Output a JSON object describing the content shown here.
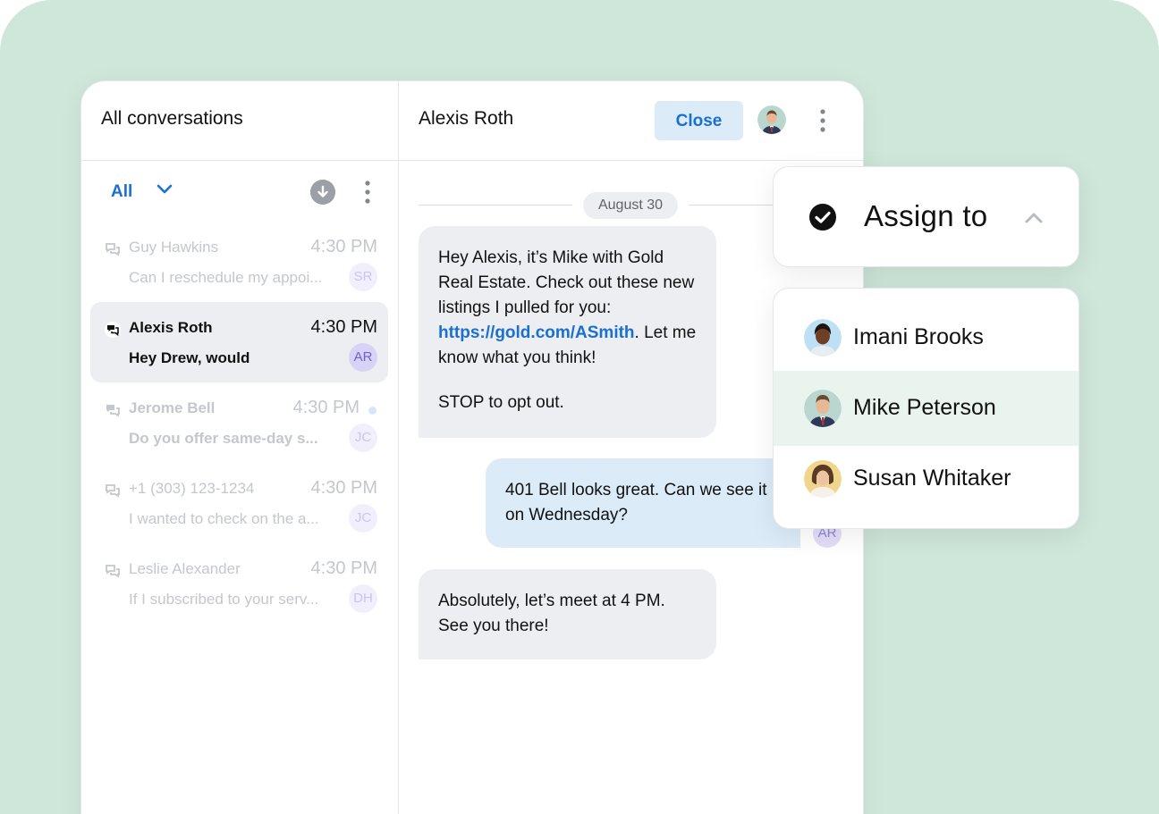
{
  "left": {
    "title": "All conversations",
    "filter_label": "All",
    "conversations": [
      {
        "name": "Guy Hawkins",
        "time": "4:30 PM",
        "preview": "Can I reschedule my appoi...",
        "initials": "SR"
      },
      {
        "name": "Alexis Roth",
        "time": "4:30 PM",
        "preview": "Hey Drew, would",
        "initials": "AR"
      },
      {
        "name": "Jerome Bell",
        "time": "4:30 PM",
        "preview": "Do you offer same-day s...",
        "initials": "JC"
      },
      {
        "name": "+1 (303) 123-1234",
        "time": "4:30 PM",
        "preview": "I wanted to check on the a...",
        "initials": "JC"
      },
      {
        "name": "Leslie Alexander",
        "time": "4:30 PM",
        "preview": "If I subscribed to your serv...",
        "initials": "DH"
      }
    ]
  },
  "right": {
    "contact_name": "Alexis Roth",
    "close_label": "Close",
    "date": "August 30",
    "messages": [
      {
        "text_before": "Hey Alexis, it’s Mike with Gold Real Estate. Check out these new listings I pulled for you: ",
        "link": "https://gold.com/ASmith",
        "text_after": ". Let me know what you think!",
        "footer": "STOP to opt out."
      },
      {
        "text": "401 Bell looks great. Can we see it on Wednesday?"
      },
      {
        "text": "Absolutely, let’s meet at 4 PM. See you there!"
      }
    ],
    "msg_avatar_initials": "AR"
  },
  "assign": {
    "title": "Assign to",
    "agents": [
      {
        "name": "Imani Brooks"
      },
      {
        "name": "Mike Peterson"
      },
      {
        "name": "Susan Whitaker"
      }
    ]
  },
  "colors": {
    "background": "#cfe6da",
    "accent": "#1a6fd1",
    "selected_row": "#eaf4ee"
  }
}
